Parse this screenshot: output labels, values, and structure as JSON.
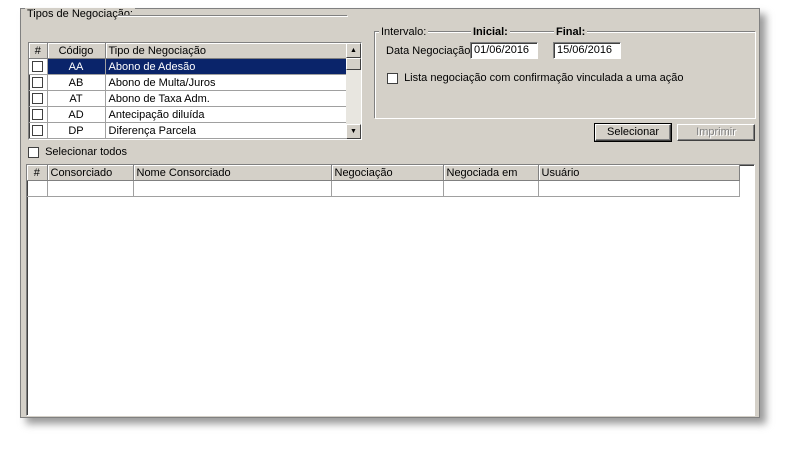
{
  "tipos": {
    "legend": "Tipos de Negociação:",
    "headers": [
      "#",
      "Código",
      "Tipo de Negociação"
    ],
    "rows": [
      {
        "codigo": "AA",
        "tipo": "Abono de Adesão",
        "selected": true
      },
      {
        "codigo": "AB",
        "tipo": "Abono de Multa/Juros",
        "selected": false
      },
      {
        "codigo": "AT",
        "tipo": "Abono de Taxa Adm.",
        "selected": false
      },
      {
        "codigo": "AD",
        "tipo": "Antecipação diluída",
        "selected": false
      },
      {
        "codigo": "DP",
        "tipo": "Diferença Parcela",
        "selected": false
      }
    ],
    "select_all_label": "Selecionar todos"
  },
  "intervalo": {
    "legend": "Intervalo:",
    "inicial_label": "Inicial:",
    "final_label": "Final:",
    "data_label": "Data Negociação:",
    "inicial_value": "01/06/2016",
    "final_value": "15/06/2016",
    "checkbox_label": "Lista negociação com confirmação vinculada a uma ação"
  },
  "buttons": {
    "selecionar": "Selecionar",
    "imprimir": "Imprimir"
  },
  "results": {
    "headers": [
      "#",
      "Consorciado",
      "Nome Consorciado",
      "Negociação",
      "Negociada em",
      "Usuário"
    ]
  },
  "colors": {
    "window_bg": "#d4d0c8",
    "selection_bg": "#0a246a"
  }
}
